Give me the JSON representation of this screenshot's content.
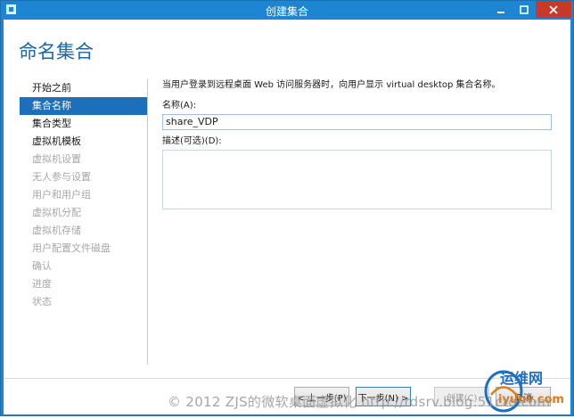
{
  "window": {
    "title": "创建集合"
  },
  "page": {
    "heading": "命名集合"
  },
  "sidebar": {
    "items": [
      {
        "label": "开始之前",
        "state": "normal"
      },
      {
        "label": "集合名称",
        "state": "active"
      },
      {
        "label": "集合类型",
        "state": "normal"
      },
      {
        "label": "虚拟机模板",
        "state": "normal"
      },
      {
        "label": "虚拟机设置",
        "state": "disabled"
      },
      {
        "label": "无人参与设置",
        "state": "disabled"
      },
      {
        "label": "用户和用户组",
        "state": "disabled"
      },
      {
        "label": "虚拟机分配",
        "state": "disabled"
      },
      {
        "label": "虚拟机存储",
        "state": "disabled"
      },
      {
        "label": "用户配置文件磁盘",
        "state": "disabled"
      },
      {
        "label": "确认",
        "state": "disabled"
      },
      {
        "label": "进度",
        "state": "disabled"
      },
      {
        "label": "状态",
        "state": "disabled"
      }
    ]
  },
  "main": {
    "intro": "当用户登录到远程桌面 Web 访问服务器时，向用户显示 virtual desktop 集合名称。",
    "name_label": "名称(A):",
    "name_value": "share_VDP",
    "description_label": "描述(可选)(D):",
    "description_value": ""
  },
  "buttons": {
    "previous": "< 上一步(P)",
    "next": "下一步(N) >",
    "create": "创建(C)",
    "cancel": "取消"
  },
  "watermark": {
    "text": "© 2012 ZJS的微软桌面虚拟化 http://rdsrv.blog.51cto.com"
  },
  "logo": {
    "main_text": "运维网",
    "sub_text": "iyunv.com"
  },
  "colors": {
    "titlebar": "#1c86d2",
    "heading": "#1a66a9",
    "active_nav": "#1c6fba",
    "close_button": "#c7392b"
  },
  "icons": {
    "app": "window-icon",
    "minimize": "minimize-icon",
    "maximize": "maximize-icon",
    "close": "close-icon"
  }
}
